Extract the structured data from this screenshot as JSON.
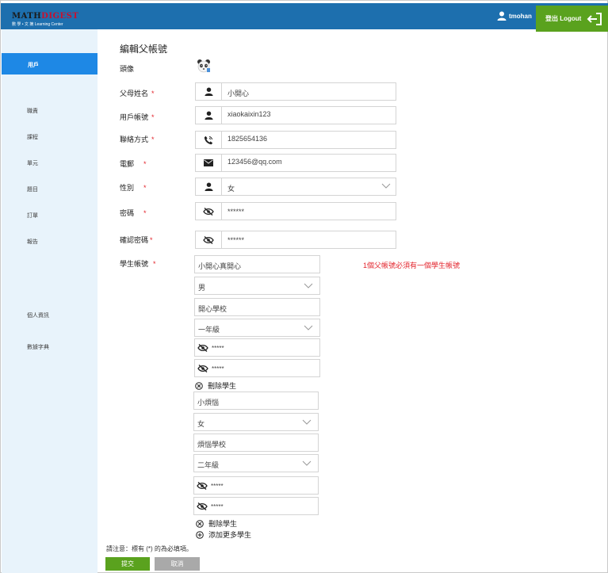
{
  "header": {
    "logo_line1_a": "MATH",
    "logo_line1_b": "DIGEST",
    "logo_line2": "數 學 • 文 摘  Learning Center",
    "username": "tmohan",
    "logout_label": "登出 Logout"
  },
  "sidebar": {
    "active": "用戶",
    "items": [
      "職責",
      "課程",
      "單元",
      "題目",
      "訂單",
      "報告",
      "個人資訊",
      "數據字典"
    ]
  },
  "form": {
    "title": "編輯父帳號",
    "avatar_label": "頭像",
    "required_mark": "*",
    "fields": {
      "parent_name": {
        "label": "父母姓名",
        "value": "小開心"
      },
      "account": {
        "label": "用戶帳號",
        "value": "xiaokaixin123"
      },
      "phone": {
        "label": "聯絡方式",
        "value": "1825654136"
      },
      "email": {
        "label": "電郵",
        "value": "123456@qq.com"
      },
      "gender": {
        "label": "性別",
        "value": "女"
      },
      "password": {
        "label": "密碼",
        "value": "******"
      },
      "confirm_password": {
        "label": "確認密碼",
        "value": "******"
      }
    },
    "students_label": "學生帳號",
    "students_note": "1個父帳號必須有一個學生帳號",
    "students": [
      {
        "name": "小開心真開心",
        "gender": "男",
        "school": "開心學校",
        "grade": "一年級",
        "password": "*****",
        "confirm": "*****",
        "remove_label": "刪除學生"
      },
      {
        "name": "小煩惱",
        "gender": "女",
        "school": "煩惱學校",
        "grade": "二年級",
        "password": "*****",
        "confirm": "*****",
        "remove_label": "刪除學生"
      }
    ],
    "add_student_label": "添加更多學生",
    "footnote": "請注意：標有 (*) 的為必填項。",
    "submit_label": "提交",
    "cancel_label": "取消"
  }
}
